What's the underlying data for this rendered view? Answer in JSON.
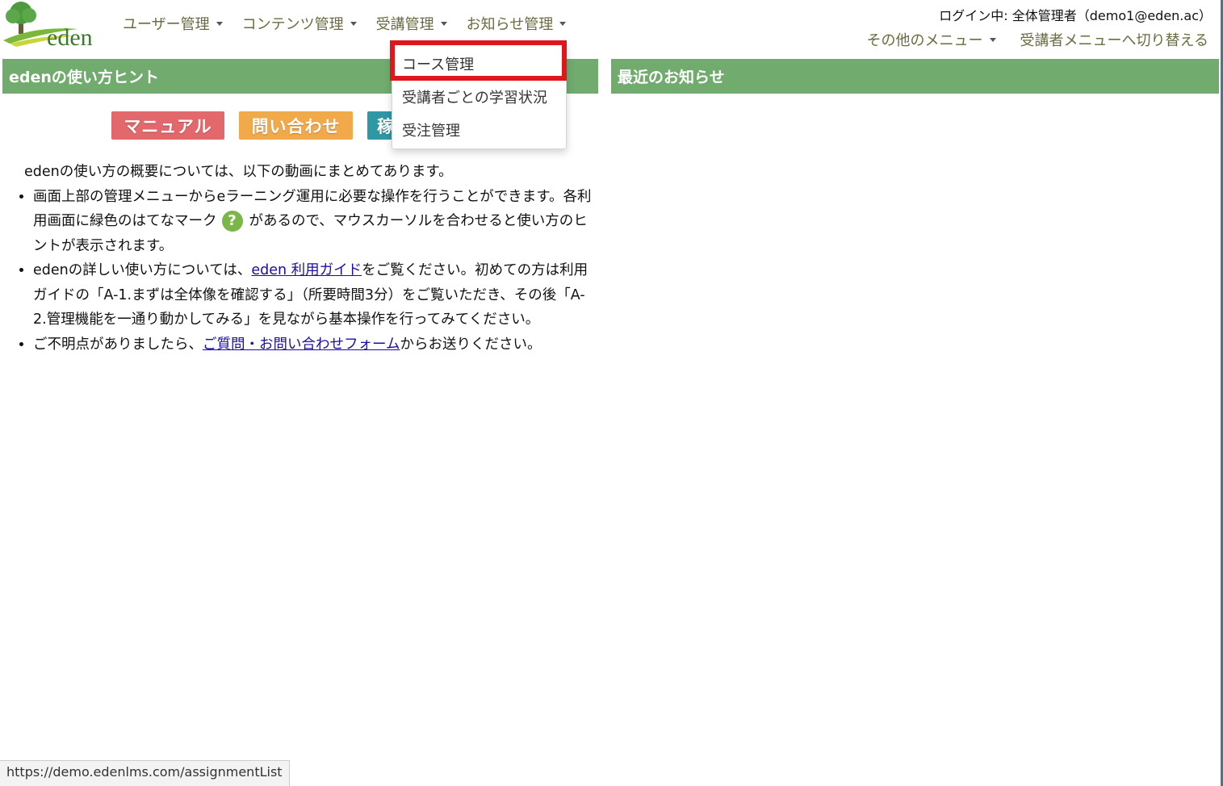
{
  "header": {
    "logo_text": "eden",
    "nav": [
      "ユーザー管理",
      "コンテンツ管理",
      "受講管理",
      "お知らせ管理"
    ],
    "login_info": "ログイン中: 全体管理者（demo1@eden.ac）",
    "right_menu": [
      "その他のメニュー",
      "受講者メニューへ切り替える"
    ]
  },
  "dropdown": {
    "items": [
      "コース管理",
      "受講者ごとの学習状況",
      "受注管理"
    ],
    "highlighted": "コース管理",
    "highlight_color": "#e0161d"
  },
  "left_panel": {
    "title": "edenの使い方ヒント",
    "buttons": [
      "マニュアル",
      "問い合わせ",
      "稼"
    ],
    "intro": "edenの使い方の概要については、以下の動画にまとめてあります。",
    "bullet1_before": "画面上部の管理メニューからeラーニング運用に必要な操作を行うことができます。各利用画面に緑色のはてなマーク",
    "bullet1_icon": "?",
    "bullet1_after": "があるので、マウスカーソルを合わせると使い方のヒントが表示されます。",
    "bullet2_link_pre": "edenの詳しい使い方については、",
    "bullet2_link": "eden 利用ガイド",
    "bullet2_after": "をご覧ください。初めての方は利用ガイドの「A-1.まずは全体像を確認する」（所要時間3分）をご覧いただき、その後「A-2.管理機能を一通り動かしてみる」を見ながら基本操作を行ってみてください。",
    "bullet3_pre": "ご不明点がありましたら、",
    "bullet3_link": "ご質問・お問い合わせフォーム",
    "bullet3_after": "からお送りください。"
  },
  "right_panel": {
    "title": "最近のお知らせ"
  },
  "statusbar": {
    "url": "https://demo.edenlms.com/assignmentList"
  },
  "colors": {
    "panel_header": "#71ab6e",
    "nav_text": "#6b6b3f",
    "link": "#1a0dab"
  }
}
